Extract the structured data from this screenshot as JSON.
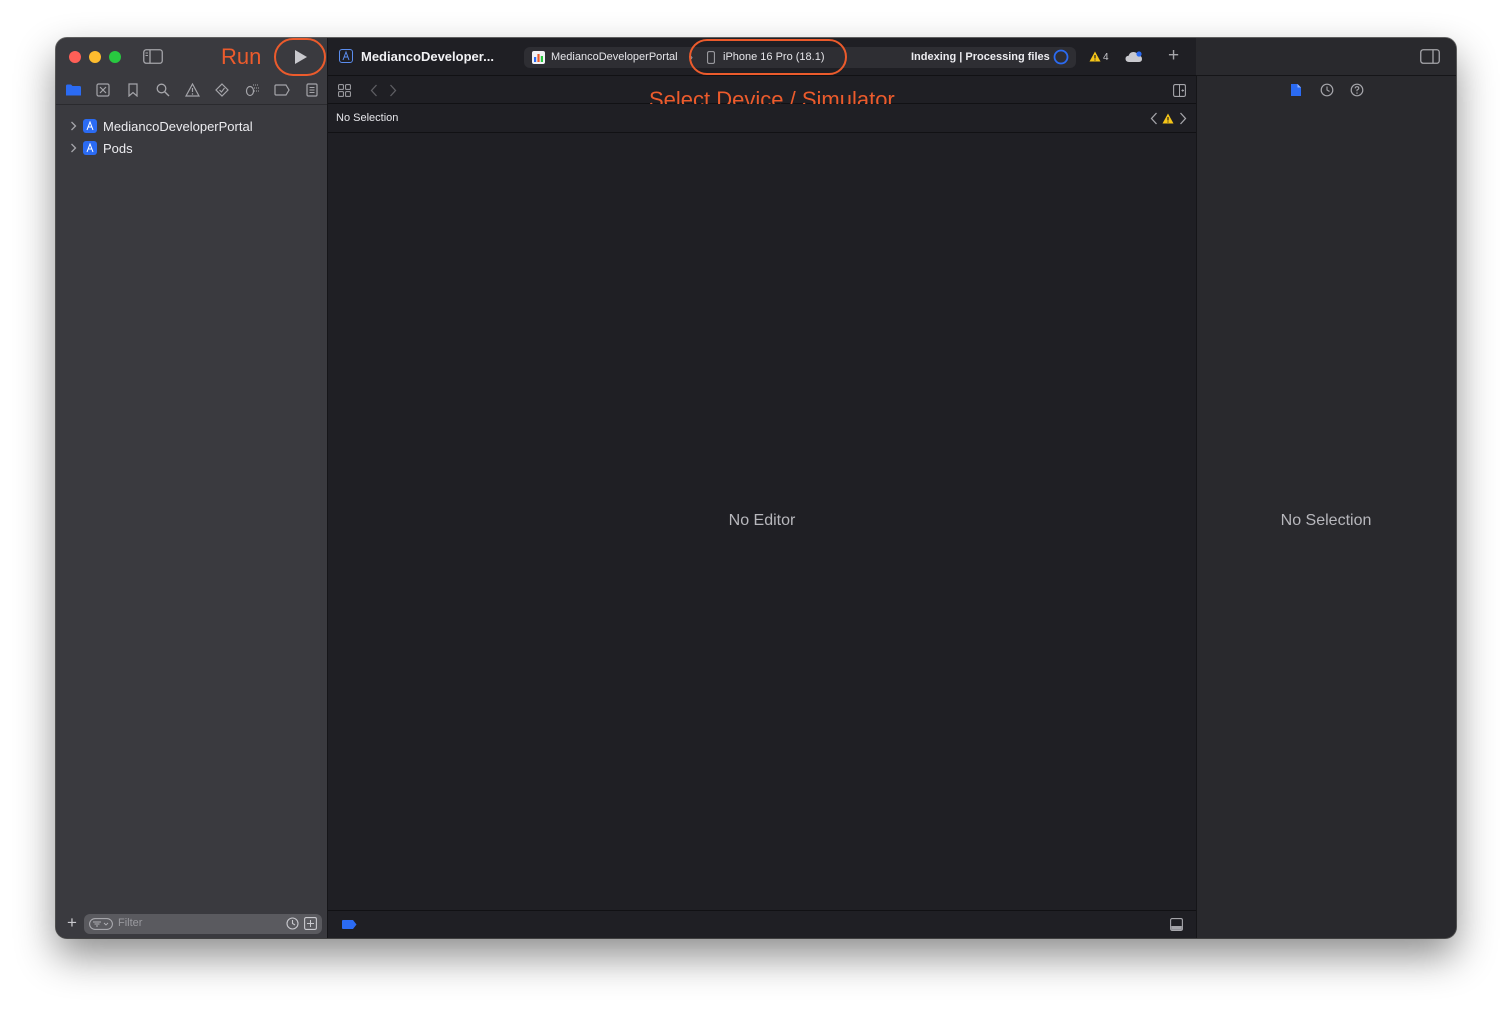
{
  "annotations": {
    "run_label": "Run",
    "device_label": "Select Device / Simulator"
  },
  "toolbar": {
    "project_title": "MediancoDeveloper...",
    "scheme_name": "MediancoDeveloperPortal",
    "scheme_separator": "›",
    "destination": "iPhone 16 Pro (18.1)",
    "activity": "Indexing | Processing files",
    "warning_count": "4",
    "add_symbol": "+"
  },
  "navigator": {
    "items": [
      {
        "label": "MediancoDeveloperPortal"
      },
      {
        "label": "Pods"
      }
    ],
    "filter_placeholder": "Filter",
    "add_symbol": "+"
  },
  "editor": {
    "path_label": "No Selection",
    "empty_label": "No Editor"
  },
  "inspector": {
    "empty_label": "No Selection"
  },
  "colors": {
    "accent": "#2b6bf3",
    "annotation": "#ec5b2c",
    "warning": "#f5c518",
    "close": "#ff5f57",
    "minimize": "#febc2e",
    "zoom": "#28c840"
  }
}
